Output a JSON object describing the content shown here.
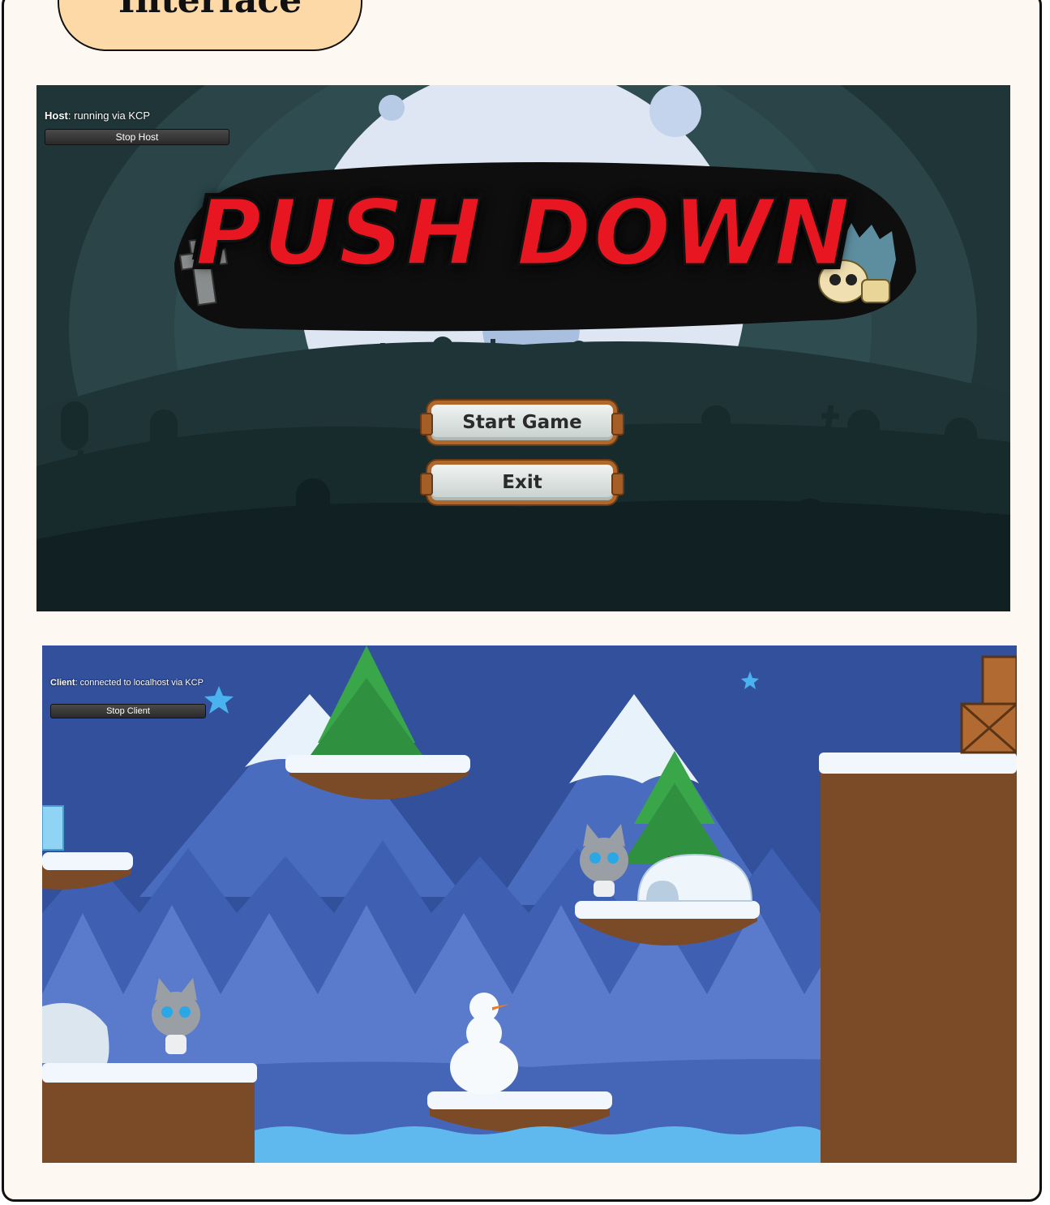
{
  "header": {
    "tab_label": "Interface"
  },
  "menu_screen": {
    "status_role": "Host",
    "status_text": ": running via KCP",
    "stop_button": "Stop Host",
    "logo_title": "PUSH DOWN",
    "start_button": "Start Game",
    "exit_button": "Exit"
  },
  "gameplay_screen": {
    "status_role": "Client",
    "status_text": ": connected to localhost via KCP",
    "stop_button": "Stop Client"
  },
  "colors": {
    "card_bg": "#fdf8f1",
    "tab_bg": "#fdd9a8",
    "logo_red": "#e81620",
    "night_sky": "#22383b",
    "winter_sky": "#3a59a6"
  }
}
